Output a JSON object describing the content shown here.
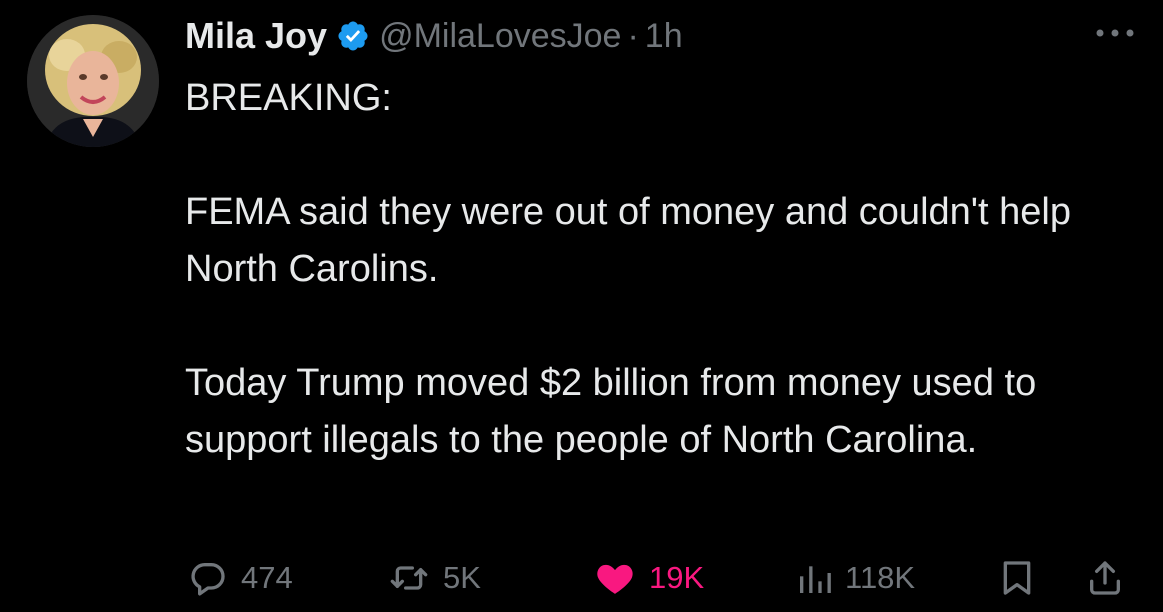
{
  "post": {
    "author": {
      "display_name": "Mila Joy",
      "handle": "@MilaLovesJoe",
      "verified": true,
      "avatar_icon": "avatar-photo"
    },
    "separator": "·",
    "time": "1h",
    "paragraphs": [
      "BREAKING:",
      "FEMA said they were out of money and couldn't help North Carolins.",
      "Today Trump moved $2 billion from money used to support illegals to the people of North Carolina."
    ],
    "stats": {
      "replies": "474",
      "reposts": "5K",
      "likes": "19K",
      "views": "118K"
    }
  },
  "colors": {
    "background": "#000000",
    "text": "#e7e9ea",
    "muted": "#71767b",
    "verified": "#1d9bf0",
    "like": "#f91880"
  },
  "icons": {
    "more": "more-dots-icon",
    "reply": "reply-bubble-icon",
    "repost": "repost-icon",
    "like": "heart-icon",
    "views": "views-bars-icon",
    "bookmark": "bookmark-icon",
    "share": "share-icon",
    "verified": "verified-badge-icon"
  }
}
